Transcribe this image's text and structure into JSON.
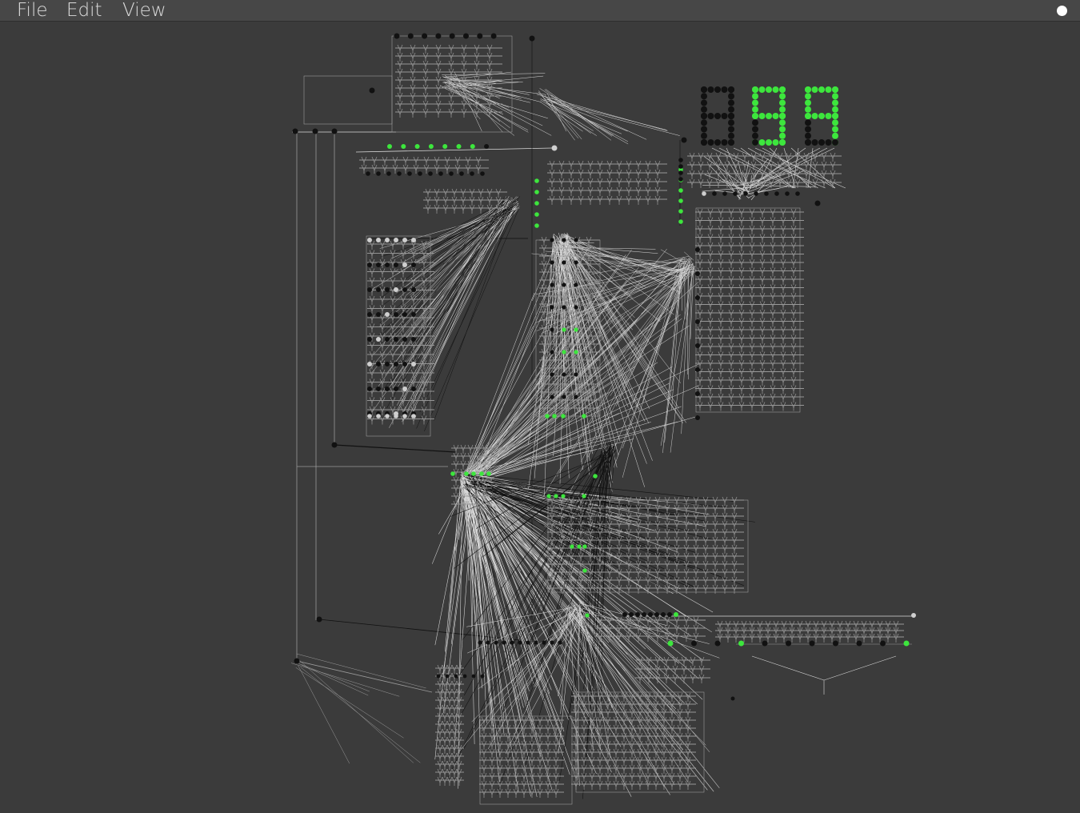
{
  "menubar": {
    "items": [
      "File",
      "Edit",
      "View"
    ]
  },
  "colors": {
    "background": "#3b3b3b",
    "menubar": "#474747",
    "menu_text": "#dcdcdc",
    "wire": "#d9d9d9",
    "wire_dim": "#9a9a9a",
    "node_off": "#111111",
    "node_on": "#3de63d",
    "node_idle": "#cfcfcf",
    "status_dot": "#ffffff"
  },
  "canvas": {
    "description_free": true,
    "seven_segment_digits": 3,
    "lit_segments": [
      [],
      [
        "a",
        "b",
        "c",
        "d",
        "f",
        "g"
      ],
      [
        "a",
        "b",
        "c",
        "f",
        "g"
      ]
    ]
  }
}
